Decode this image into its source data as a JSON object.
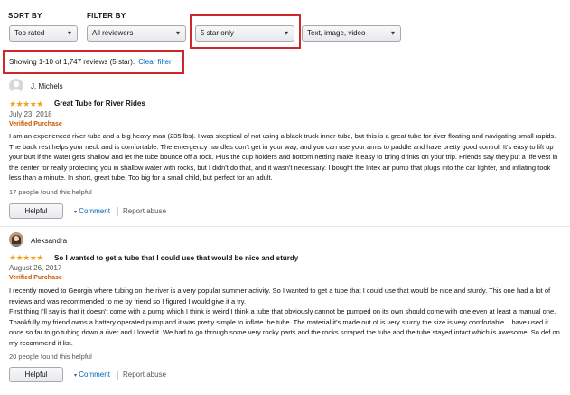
{
  "filters": {
    "sort_label": "SORT BY",
    "filter_label": "FILTER BY",
    "sort_value": "Top rated",
    "reviewers_value": "All reviewers",
    "star_value": "5 star only",
    "format_value": "Text, image, video"
  },
  "summary": {
    "showing_text": "Showing 1-10 of 1,747 reviews (5 star).",
    "clear_filter": "Clear filter"
  },
  "colors": {
    "accent_red": "#d0272b",
    "link": "#0066c0",
    "star": "#f0a31c",
    "verified": "#c45500"
  },
  "reviews": [
    {
      "author": "J. Michels",
      "stars": "★★★★★",
      "rating": 5,
      "title": "Great Tube for River Rides",
      "date": "July 23, 2018",
      "verified": "Verified Purchase",
      "body": "I am an experienced river-tube and a big heavy man (235 lbs). I was skeptical of not using a black truck inner-tube, but this is a great tube for river floating and navigating small rapids. The back rest helps your neck and is comfortable. The emergency handles don't get in your way, and you can use your arms to paddle and have pretty good control. It's easy to lift up your butt if the water gets shallow and let the tube bounce off a rock. Plus the cup holders and bottom netting make it easy to bring drinks on your trip. Friends say they put a life vest in the center for really protecting you in shallow water with rocks, but I didn't do that, and it wasn't necessary. I bought the Intex air pump that plugs into the car lighter, and inflating took less than a minute. In short, great tube. Too big for a small child, but perfect for an adult.",
      "helpful_count": "17 people found this helpful",
      "helpful_btn": "Helpful",
      "comment": "Comment",
      "report": "Report abuse"
    },
    {
      "author": "Aleksandra",
      "stars": "★★★★★",
      "rating": 5,
      "title": "So I wanted to get a tube that I could use that would be nice and sturdy",
      "date": "August 26, 2017",
      "verified": "Verified Purchase",
      "body": "I recently moved to Georgia where tubing on the river is a very popular summer activity. So I wanted to get a tube that I could use that would be nice and sturdy. This one had a lot of reviews and was recommended to me by friend so I figured I would give it a try.\nFirst thing I'll say is that it doesn't come with a pump which I think is weird I think a tube that obviously cannot be pumped on its own should come with one even at least a manual one. Thankfully my friend owns a battery operated pump and it was pretty simple to inflate the tube. The material it's made out of is very sturdy the size is very comfortable. I have used it once so far to go tubing down a river and I loved it. We had to go through some very rocky parts and the rocks scraped the tube and the tube stayed intact which is awesome. So def on my recommend it list.",
      "helpful_count": "20 people found this helpful",
      "helpful_btn": "Helpful",
      "comment": "Comment",
      "report": "Report abuse"
    }
  ]
}
